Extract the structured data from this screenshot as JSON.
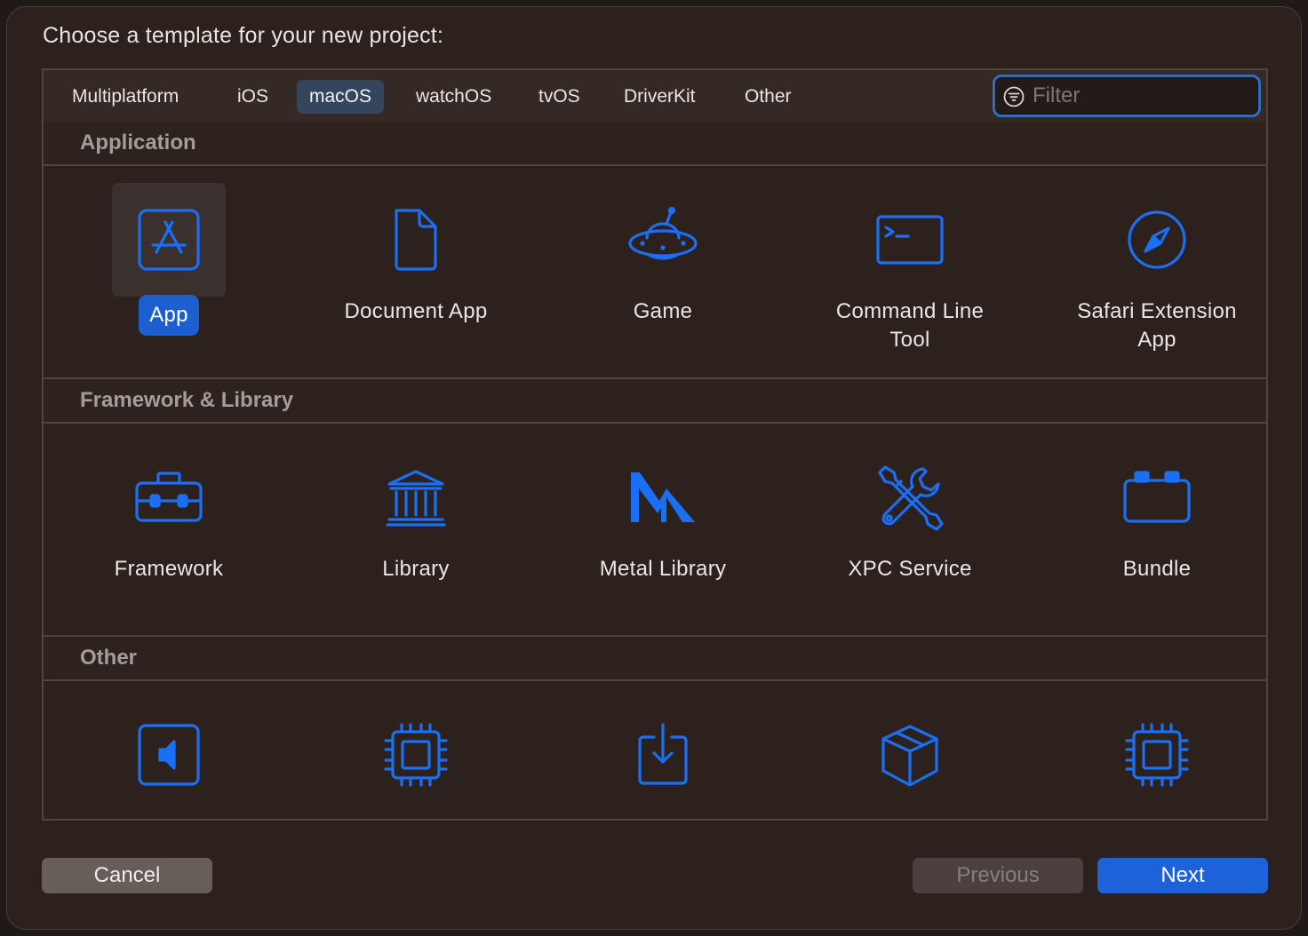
{
  "prompt": "Choose a template for your new project:",
  "tabs": [
    {
      "label": "Multiplatform",
      "selected": false
    },
    {
      "label": "iOS",
      "selected": false
    },
    {
      "label": "macOS",
      "selected": true
    },
    {
      "label": "watchOS",
      "selected": false
    },
    {
      "label": "tvOS",
      "selected": false
    },
    {
      "label": "DriverKit",
      "selected": false
    },
    {
      "label": "Other",
      "selected": false
    }
  ],
  "filter": {
    "placeholder": "Filter",
    "value": "",
    "icon": "filter-icon"
  },
  "sections": {
    "application": {
      "title": "Application",
      "items": [
        {
          "label": "App",
          "icon": "app-store-icon",
          "selected": true
        },
        {
          "label": "Document App",
          "icon": "document-icon",
          "selected": false
        },
        {
          "label": "Game",
          "icon": "ufo-icon",
          "selected": false
        },
        {
          "label": "Command Line Tool",
          "icon": "terminal-icon",
          "selected": false
        },
        {
          "label": "Safari Extension App",
          "icon": "compass-icon",
          "selected": false
        }
      ]
    },
    "framework": {
      "title": "Framework & Library",
      "items": [
        {
          "label": "Framework",
          "icon": "toolbox-icon"
        },
        {
          "label": "Library",
          "icon": "building-columns-icon"
        },
        {
          "label": "Metal Library",
          "icon": "metal-icon"
        },
        {
          "label": "XPC Service",
          "icon": "wrench-screwdriver-icon"
        },
        {
          "label": "Bundle",
          "icon": "bundle-icon"
        }
      ]
    },
    "other": {
      "title": "Other",
      "items": [
        {
          "label": "",
          "icon": "speaker-icon"
        },
        {
          "label": "",
          "icon": "chip-icon"
        },
        {
          "label": "",
          "icon": "download-tray-icon"
        },
        {
          "label": "",
          "icon": "package-icon"
        },
        {
          "label": "",
          "icon": "chip-icon"
        }
      ]
    }
  },
  "buttons": {
    "cancel": "Cancel",
    "previous": "Previous",
    "next": "Next"
  },
  "colors": {
    "accent": "#1d62d8",
    "icon_blue": "#1a6ff4",
    "background": "#2c211d"
  }
}
